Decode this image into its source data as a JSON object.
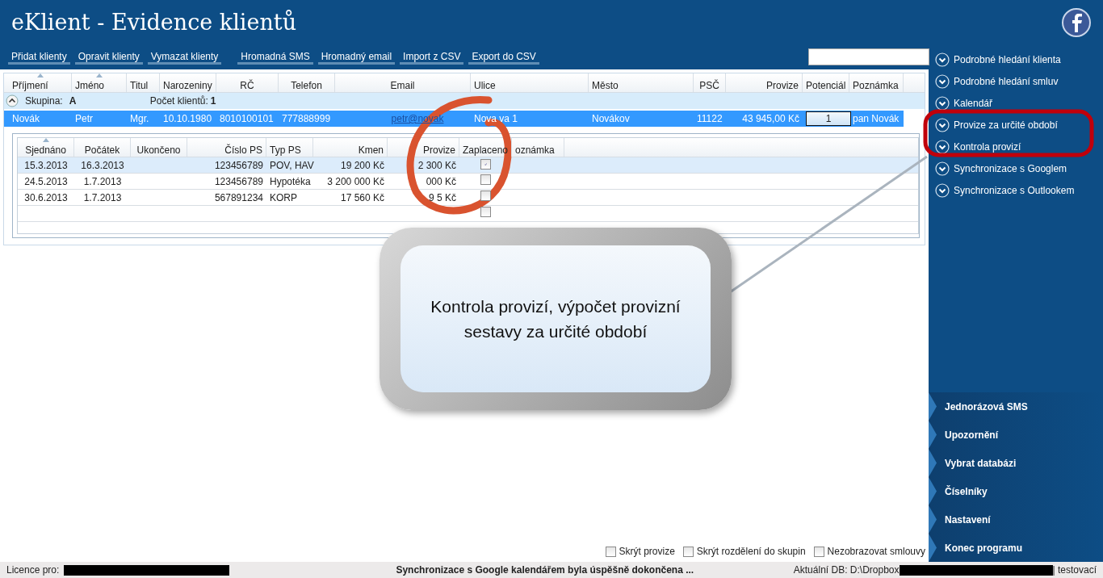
{
  "window": {
    "title": "eKlient - Evidence klientů"
  },
  "toolbar": {
    "groups": [
      [
        "Přidat klienty",
        "Opravit klienty",
        "Vymazat klienty"
      ],
      [
        "Hromadná SMS",
        "Hromadný email",
        "Import z CSV",
        "Export do CSV"
      ]
    ]
  },
  "clients_table": {
    "columns": [
      {
        "label": "Příjmení",
        "sorted": true
      },
      {
        "label": "Jméno",
        "sorted": true
      },
      {
        "label": "Titul",
        "sorted": false
      },
      {
        "label": "Narozeniny",
        "sorted": false
      },
      {
        "label": "RČ",
        "sorted": false
      },
      {
        "label": "Telefon",
        "sorted": false
      },
      {
        "label": "Email",
        "sorted": false
      },
      {
        "label": "Ulice",
        "sorted": false
      },
      {
        "label": "Město",
        "sorted": false
      },
      {
        "label": "PSČ",
        "sorted": false
      },
      {
        "label": "Provize",
        "sorted": false
      },
      {
        "label": "Potenciál",
        "sorted": false
      },
      {
        "label": "Poznámka",
        "sorted": false
      }
    ],
    "group": {
      "expanded": true,
      "label": "Skupina:",
      "value": "A",
      "count_label": "Počet klientů:",
      "count": "1"
    },
    "rows": [
      {
        "selected": true,
        "cells": [
          "Novák",
          "Petr",
          "Mgr.",
          "10.10.1980",
          "8010100101",
          "777888999",
          "petr@novak",
          "Nova  va 1",
          "Novákov",
          "11122",
          "43 945,00 Kč",
          "1",
          "pan Novák"
        ]
      }
    ]
  },
  "contracts_table": {
    "columns": [
      {
        "label": "Sjednáno",
        "sorted": true
      },
      {
        "label": "Počátek",
        "sorted": false
      },
      {
        "label": "Ukončeno",
        "sorted": false
      },
      {
        "label": "Číslo PS",
        "sorted": false
      },
      {
        "label": "Typ PS",
        "sorted": false
      },
      {
        "label": "Kmen",
        "sorted": false
      },
      {
        "label": "Provize",
        "sorted": false
      },
      {
        "label": "Zaplaceno",
        "sorted": false
      },
      {
        "label": "oznámka",
        "sorted": false
      }
    ],
    "rows": [
      {
        "kind": "data",
        "selected": true,
        "paid": true,
        "cells": [
          "15.3.2013",
          "16.3.2013",
          "",
          "123456789",
          "POV, HAV",
          "19 200 Kč",
          "2 300 Kč"
        ]
      },
      {
        "kind": "data",
        "selected": false,
        "paid": false,
        "cells": [
          "24.5.2013",
          "1.7.2013",
          "",
          "123456789",
          "Hypotéka",
          "3 200 000 Kč",
          "000 Kč"
        ]
      },
      {
        "kind": "data",
        "selected": false,
        "paid": false,
        "cells": [
          "30.6.2013",
          "1.7.2013",
          "",
          "567891234",
          "KORP",
          "17 560 Kč",
          "9  5 Kč"
        ]
      },
      {
        "kind": "new",
        "selected": false,
        "paid": false,
        "cells": []
      }
    ]
  },
  "sidebar": {
    "links": [
      "Podrobné hledání klienta",
      "Podrobné hledání smluv",
      "Kalendář",
      "Provize za určité období",
      "Kontrola provizí",
      "Synchronizace s Googlem",
      "Synchronizace s Outlookem"
    ],
    "nav": [
      "Jednorázová SMS",
      "Upozornění",
      "Vybrat databázi",
      "Číselníky",
      "Nastavení",
      "Konec programu"
    ]
  },
  "options": [
    {
      "label": "Skrýt provize",
      "checked": false
    },
    {
      "label": "Skrýt rozdělení do skupin",
      "checked": false
    },
    {
      "label": "Nezobrazovat smlouvy",
      "checked": false
    }
  ],
  "status_bar": {
    "licence_label": "Licence pro:",
    "message": "Synchronizace s Google kalendářem byla úspěšně dokončena ...",
    "db_label": "Aktuální DB: D:\\Dropbox",
    "db_suffix": "| testovací"
  },
  "callout": {
    "text": "Kontrola provizí, výpočet provizní sestavy za určité období"
  }
}
